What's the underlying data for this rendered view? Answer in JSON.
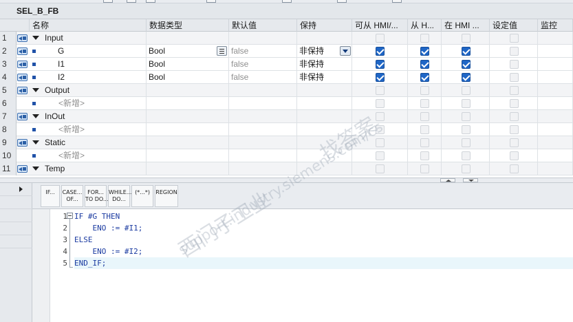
{
  "editor_title": "SEL_B_FB",
  "columns": [
    {
      "key": "name",
      "label": "名称"
    },
    {
      "key": "datatype",
      "label": "数据类型"
    },
    {
      "key": "default",
      "label": "默认值"
    },
    {
      "key": "retain",
      "label": "保持"
    },
    {
      "key": "hmi_access",
      "label": "可从 HMI/..."
    },
    {
      "key": "hmi_from",
      "label": "从 H..."
    },
    {
      "key": "hmi_in",
      "label": "在 HMI ..."
    },
    {
      "key": "setpoint",
      "label": "设定值"
    },
    {
      "key": "monitor",
      "label": "监控"
    }
  ],
  "rows": [
    {
      "num": "1",
      "kind": "section",
      "name": "Input",
      "icon": "io-param-icon"
    },
    {
      "num": "2",
      "kind": "var",
      "name": "G",
      "datatype": "Bool",
      "default": "false",
      "retain": "非保持",
      "hmi": [
        true,
        true,
        true
      ],
      "selected": true
    },
    {
      "num": "3",
      "kind": "var",
      "name": "I1",
      "datatype": "Bool",
      "default": "false",
      "retain": "非保持",
      "hmi": [
        true,
        true,
        true
      ]
    },
    {
      "num": "4",
      "kind": "var",
      "name": "I2",
      "datatype": "Bool",
      "default": "false",
      "retain": "非保持",
      "hmi": [
        true,
        true,
        true
      ]
    },
    {
      "num": "5",
      "kind": "section",
      "name": "Output",
      "icon": "io-param-icon"
    },
    {
      "num": "6",
      "kind": "add",
      "name": "<新增>"
    },
    {
      "num": "7",
      "kind": "section",
      "name": "InOut",
      "icon": "io-param-icon"
    },
    {
      "num": "8",
      "kind": "add",
      "name": "<新增>"
    },
    {
      "num": "9",
      "kind": "section",
      "name": "Static",
      "icon": "io-param-icon"
    },
    {
      "num": "10",
      "kind": "add",
      "name": "<新增>"
    },
    {
      "num": "11",
      "kind": "section",
      "name": "Temp",
      "icon": "io-param-icon"
    }
  ],
  "keyword_buttons": [
    {
      "label": "IF...",
      "name": "kw-if-button"
    },
    {
      "label": "CASE...\nOF...",
      "name": "kw-case-button"
    },
    {
      "label": "FOR...\nTO DO...",
      "name": "kw-for-button"
    },
    {
      "label": "WHILE...\nDO...",
      "name": "kw-while-button"
    },
    {
      "label": "(*...*)",
      "name": "kw-comment-button"
    },
    {
      "label": "REGION",
      "name": "kw-region-button"
    }
  ],
  "code_lines": [
    {
      "num": "1",
      "text": "IF #G THEN"
    },
    {
      "num": "2",
      "text": "    ENO := #I1;"
    },
    {
      "num": "3",
      "text": "ELSE"
    },
    {
      "num": "4",
      "text": "    ENO := #I2;"
    },
    {
      "num": "5",
      "text": "END_IF;"
    }
  ],
  "watermark": {
    "line1": "找答案",
    "line2": "西门子工业",
    "line3": "support.industry.siemens.com/cs"
  }
}
